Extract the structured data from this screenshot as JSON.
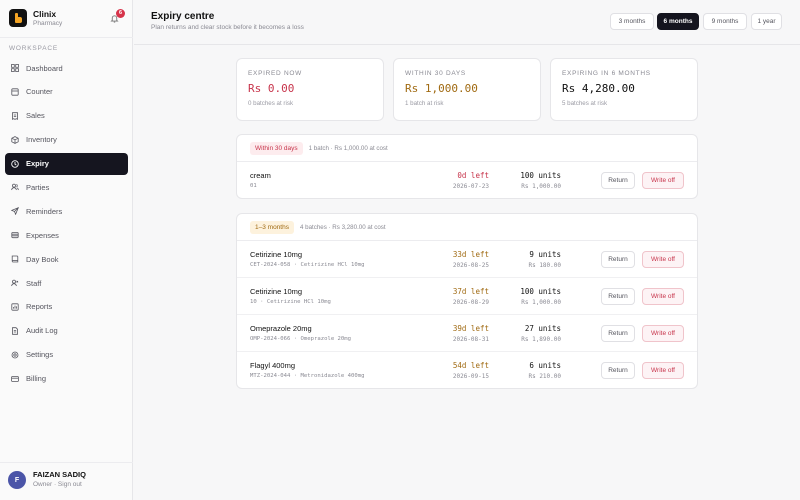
{
  "brand": {
    "name": "Clinix",
    "sub": "Pharmacy",
    "notifications": "6"
  },
  "sidebar": {
    "section": "WORKSPACE",
    "items": [
      {
        "label": "Dashboard",
        "icon": "grid-icon"
      },
      {
        "label": "Counter",
        "icon": "counter-icon"
      },
      {
        "label": "Sales",
        "icon": "receipt-icon"
      },
      {
        "label": "Inventory",
        "icon": "box-icon"
      },
      {
        "label": "Expiry",
        "icon": "clock-icon",
        "active": true
      },
      {
        "label": "Parties",
        "icon": "users-icon"
      },
      {
        "label": "Reminders",
        "icon": "send-icon"
      },
      {
        "label": "Expenses",
        "icon": "wallet-icon"
      },
      {
        "label": "Day Book",
        "icon": "book-icon"
      },
      {
        "label": "Staff",
        "icon": "user-group-icon"
      },
      {
        "label": "Reports",
        "icon": "chart-icon"
      },
      {
        "label": "Audit Log",
        "icon": "log-icon"
      },
      {
        "label": "Settings",
        "icon": "gear-icon"
      },
      {
        "label": "Billing",
        "icon": "card-icon"
      }
    ]
  },
  "user": {
    "initial": "F",
    "name": "FAIZAN SADIQ",
    "sub": "Owner · Sign out"
  },
  "header": {
    "title": "Expiry centre",
    "subtitle": "Plan returns and clear stock before it becomes a loss",
    "ranges": [
      "3 months",
      "6 months",
      "9 months",
      "1 year"
    ],
    "active_range": "6 months"
  },
  "stats": [
    {
      "label": "EXPIRED NOW",
      "value": "Rs 0.00",
      "sub": "0 batches at risk",
      "color": "#c7344b"
    },
    {
      "label": "WITHIN 30 DAYS",
      "value": "Rs 1,000.00",
      "sub": "1 batch at risk",
      "color": "#a06a12"
    },
    {
      "label": "EXPIRING IN 6 MONTHS",
      "value": "Rs 4,280.00",
      "sub": "5 batches at risk",
      "color": "#111111"
    }
  ],
  "groups": [
    {
      "badge": "Within 30 days",
      "meta": "1 batch · Rs 1,000.00 at cost",
      "rows": [
        {
          "name": "cream",
          "sub": "01",
          "left": "0d left",
          "date": "2026-07-23",
          "units": "100 units",
          "cost": "Rs 1,000.00"
        }
      ]
    },
    {
      "badge": "1–3 months",
      "meta": "4 batches · Rs 3,280.00 at cost",
      "rows": [
        {
          "name": "Cetirizine 10mg",
          "sub": "CET-2024-058 · Cetirizine HCl 10mg",
          "left": "33d left",
          "date": "2026-08-25",
          "units": "9 units",
          "cost": "Rs 180.00"
        },
        {
          "name": "Cetirizine 10mg",
          "sub": "10 · Cetirizine HCl 10mg",
          "left": "37d left",
          "date": "2026-08-29",
          "units": "100 units",
          "cost": "Rs 1,000.00"
        },
        {
          "name": "Omeprazole 20mg",
          "sub": "OMP-2024-066 · Omeprazole 20mg",
          "left": "39d left",
          "date": "2026-08-31",
          "units": "27 units",
          "cost": "Rs 1,890.00"
        },
        {
          "name": "Flagyl 400mg",
          "sub": "MTZ-2024-044 · Metronidazole 400mg",
          "left": "54d left",
          "date": "2026-09-15",
          "units": "6 units",
          "cost": "Rs 210.00"
        }
      ]
    }
  ],
  "actions": {
    "return": "Return",
    "write_off": "Write off"
  }
}
